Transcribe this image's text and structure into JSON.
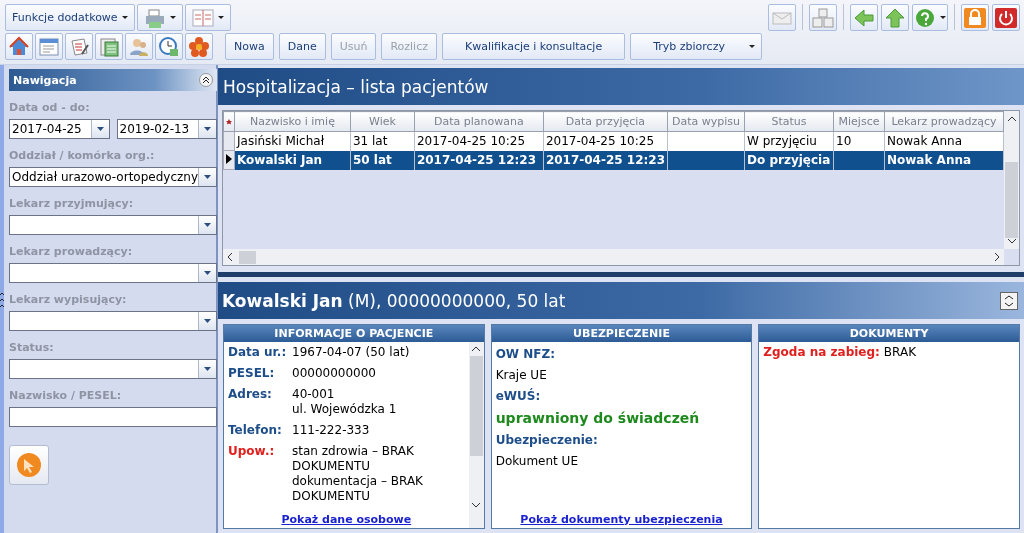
{
  "toolbar": {
    "menu_label": "Funkcje dodatkowe",
    "buttons": [
      {
        "label": "Nowa",
        "disabled": false,
        "kind": "plain"
      },
      {
        "label": "Dane",
        "disabled": false,
        "kind": "plain"
      },
      {
        "label": "Usuń",
        "disabled": true,
        "kind": "plain"
      },
      {
        "label": "Rozlicz",
        "disabled": true,
        "kind": "plain"
      },
      {
        "label": "Kwalifikacje i konsultacje",
        "disabled": false,
        "kind": "plain"
      },
      {
        "label": "Tryb zbiorczy",
        "disabled": false,
        "kind": "dropdown"
      }
    ]
  },
  "sidebar": {
    "title": "Nawigacja",
    "fields": [
      {
        "label": "Data od - do:",
        "kind": "date_range",
        "values": [
          "2017-04-25",
          "2019-02-13"
        ]
      },
      {
        "label": "Oddział / komórka org.:",
        "kind": "select",
        "value": "Oddział urazowo-ortopedyczny"
      },
      {
        "label": "Lekarz przyjmujący:",
        "kind": "select"
      },
      {
        "label": "Lekarz prowadzący:",
        "kind": "select"
      },
      {
        "label": "Lekarz wypisujący:",
        "kind": "select"
      },
      {
        "label": "Status:",
        "kind": "select"
      },
      {
        "label": "Nazwisko / PESEL:",
        "kind": "text"
      }
    ]
  },
  "list": {
    "title": "Hospitalizacja – lista pacjentów",
    "columns": [
      "Nazwisko i imię",
      "Wiek",
      "Data planowana",
      "Data przyjęcia",
      "Data wypisu",
      "Status",
      "Miejsce",
      "Lekarz prowadzący"
    ],
    "rows": [
      {
        "selected": false,
        "cells": [
          "Jasiński Michał",
          "31 lat",
          "2017-04-25 10:25",
          "2017-04-25 10:25",
          "",
          "W przyjęciu",
          "10",
          "Nowak Anna"
        ]
      },
      {
        "selected": true,
        "cells": [
          "Kowalski Jan",
          "50 lat",
          "2017-04-25 12:23",
          "2017-04-25 12:23",
          "",
          "Do przyjęcia",
          "",
          "Nowak Anna"
        ]
      }
    ]
  },
  "patient": {
    "name": "Kowalski Jan",
    "details": "(M), 00000000000, 50 lat",
    "panels": [
      {
        "title": "INFORMACJE O PACJENCIE",
        "kind": "table",
        "scrollable": true,
        "link": "Pokaż dane osobowe",
        "items": [
          {
            "label": "Data ur.:",
            "alert": false,
            "lines": [
              "1967-04-07 (50 lat)"
            ]
          },
          {
            "label": "PESEL:",
            "alert": false,
            "lines": [
              "00000000000"
            ]
          },
          {
            "label": "Adres:",
            "alert": false,
            "lines": [
              "40-001",
              "ul. Wojewódzka 1"
            ]
          },
          {
            "label": "Telefon:",
            "alert": false,
            "lines": [
              "111-222-333"
            ]
          },
          {
            "label": "Upow.:",
            "alert": true,
            "lines": [
              "stan zdrowia – BRAK",
              "DOKUMENTU",
              "dokumentacja – BRAK",
              "DOKUMENTU"
            ]
          }
        ]
      },
      {
        "title": "UBEZPIECZENIE",
        "kind": "stack",
        "scrollable": false,
        "link": "Pokaż dokumenty ubezpieczenia",
        "items": [
          {
            "kind": "label",
            "text": "OW NFZ:"
          },
          {
            "kind": "value",
            "text": "Kraje UE"
          },
          {
            "kind": "label",
            "text": "eWUŚ:"
          },
          {
            "kind": "status",
            "text": "uprawniony do świadczeń"
          },
          {
            "kind": "label",
            "text": "Ubezpieczenie:"
          },
          {
            "kind": "value",
            "text": "Dokument UE"
          }
        ]
      },
      {
        "title": "DOKUMENTY",
        "kind": "table",
        "scrollable": false,
        "items": [
          {
            "label": "Zgoda na zabieg:",
            "alert": true,
            "lines": [
              "BRAK"
            ]
          }
        ]
      }
    ]
  }
}
